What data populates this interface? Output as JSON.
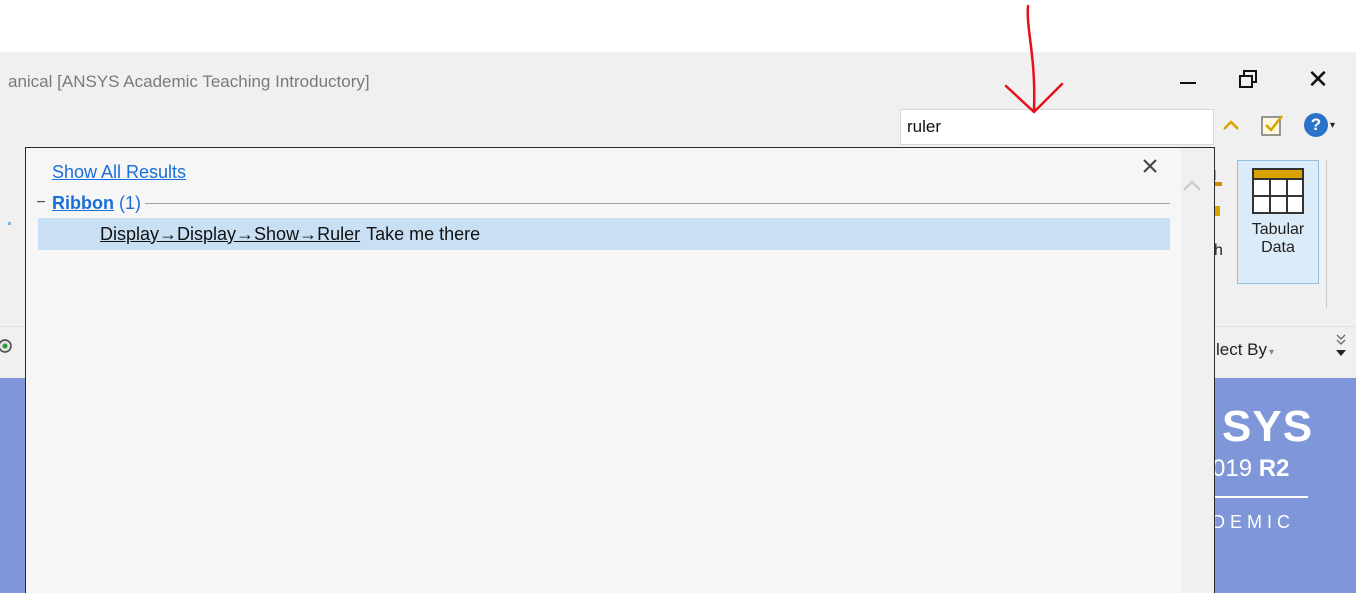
{
  "window": {
    "title": "anical [ANSYS Academic Teaching Introductory]",
    "minimize_glyph": "",
    "restore_glyph": "🗗",
    "close_glyph": "✕"
  },
  "search": {
    "value": "ruler"
  },
  "help_toolbar": {
    "collapse_glyph": "^",
    "help_glyph": "?",
    "help_caret": "▾"
  },
  "ribbon": {
    "partial_button_label": "h",
    "tabular_data_label": "Tabular Data",
    "scroll_up_glyph": "^"
  },
  "toolbar": {
    "select_by_label": "lect By",
    "select_by_caret": "▾",
    "overflow_glyph": "»"
  },
  "brand": {
    "name": "SYS",
    "version_prefix": "019",
    "version_suffix": "R2",
    "edition": "DEMIC"
  },
  "search_results": {
    "show_all_label": "Show All Results",
    "close_glyph": "✕",
    "groups": [
      {
        "expander": "−",
        "name": "Ribbon",
        "count": "(1)",
        "items": [
          {
            "path": "Display→Display→Show→Ruler",
            "action": "Take me there"
          }
        ]
      }
    ]
  },
  "annotation": {
    "arrow_color": "#e8101a"
  },
  "colors": {
    "link_blue": "#1a6ed8",
    "selection_blue": "#c9dff3",
    "brand_blue": "#7f96d8",
    "chrome_gray": "#f0f0f0"
  }
}
